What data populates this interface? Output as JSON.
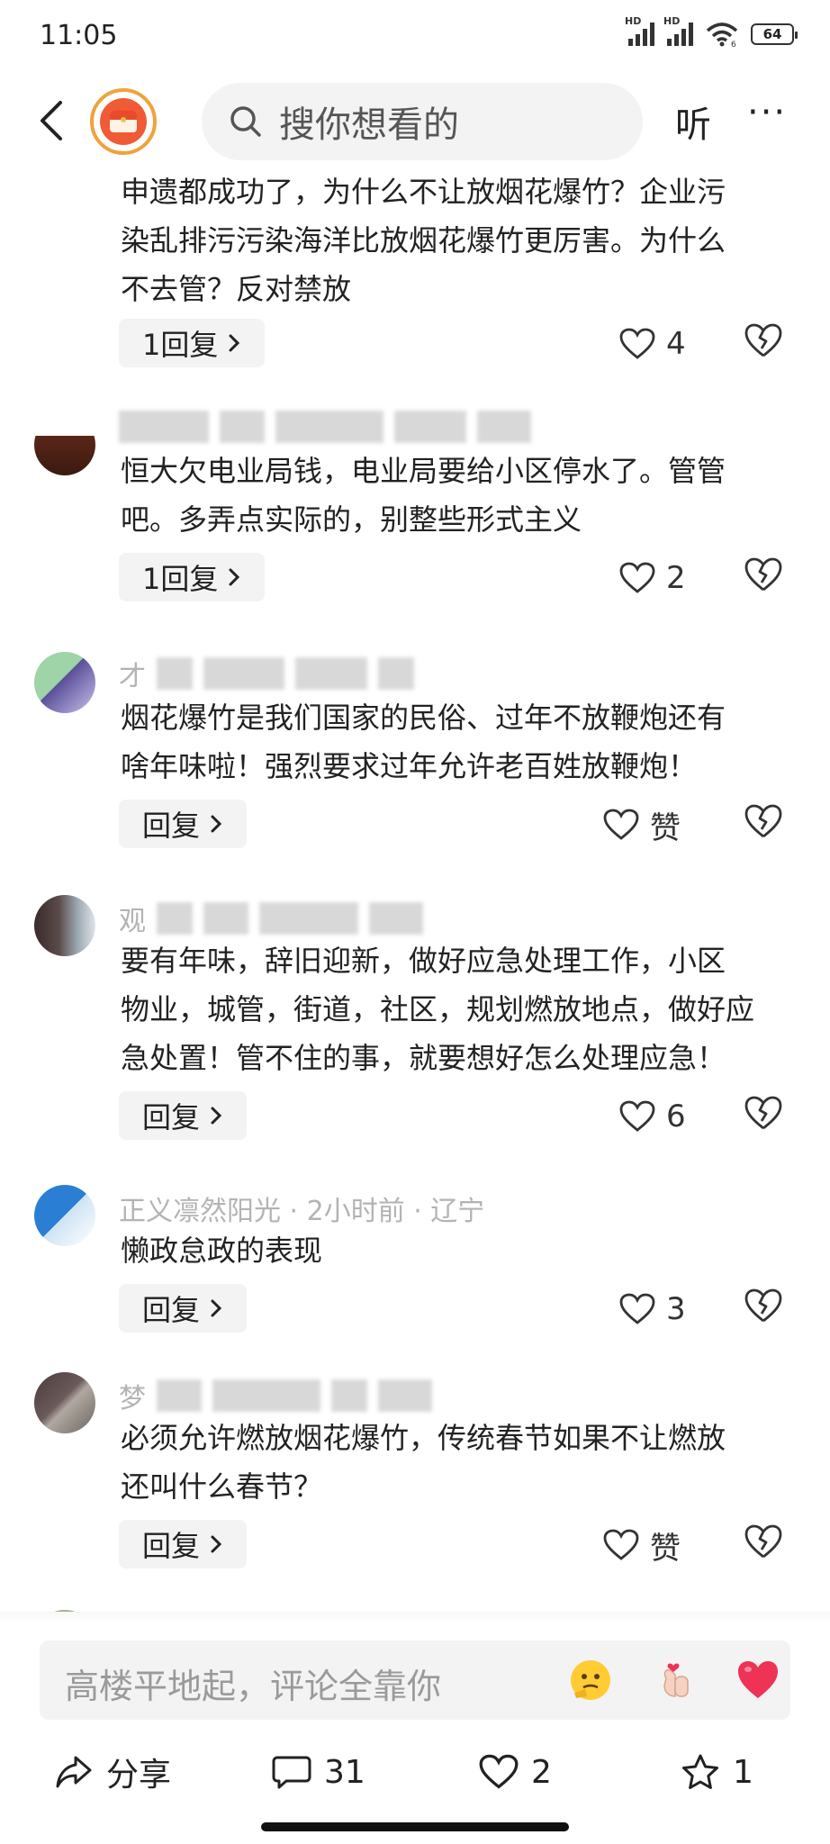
{
  "status_bar": {
    "time": "11:05",
    "sim1_label": "HD",
    "sim2_label": "HD",
    "wifi_label": "6",
    "battery": "64"
  },
  "header": {
    "search_placeholder": "搜你想看的",
    "listen_label": "听",
    "more_label": "···"
  },
  "comments": [
    {
      "meta": "",
      "text_lines": [
        "申遗都成功了，为什么不让放烟花爆竹？企业污",
        "染乱排污污染海洋比放烟花爆竹更厉害。为什么",
        "不去管？反对禁放"
      ],
      "reply_label": "1回复",
      "like_count": "4"
    },
    {
      "meta": "",
      "text_lines": [
        "恒大欠电业局钱，电业局要给小区停水了。管管",
        "吧。多弄点实际的，别整些形式主义"
      ],
      "reply_label": "1回复",
      "like_count": "2"
    },
    {
      "meta": "才",
      "text_lines": [
        "烟花爆竹是我们国家的民俗、过年不放鞭炮还有",
        "啥年味啦！强烈要求过年允许老百姓放鞭炮！"
      ],
      "reply_label": "回复",
      "like_count": "赞"
    },
    {
      "meta": "观",
      "text_lines": [
        "要有年味，辞旧迎新，做好应急处理工作，小区",
        "物业，城管，街道，社区，规划燃放地点，做好应",
        "急处置！管不住的事，就要想好怎么处理应急！"
      ],
      "reply_label": "回复",
      "like_count": "6"
    },
    {
      "meta": "正义凛然阳光 · 2小时前 · 辽宁",
      "text_lines": [
        "懒政怠政的表现"
      ],
      "reply_label": "回复",
      "like_count": "3"
    },
    {
      "meta": "梦",
      "text_lines": [
        "必须允许燃放烟花爆竹，传统春节如果不让燃放",
        "还叫什么春节？"
      ],
      "reply_label": "回复",
      "like_count": "赞"
    }
  ],
  "input_bar": {
    "placeholder": "高楼平地起，评论全靠你"
  },
  "action_bar": {
    "share_label": "分享",
    "comment_count": "31",
    "like_count": "2",
    "favorite_count": "1"
  },
  "colors": {
    "brand_orange": "#f05a35",
    "heart_red": "#ee3355"
  }
}
